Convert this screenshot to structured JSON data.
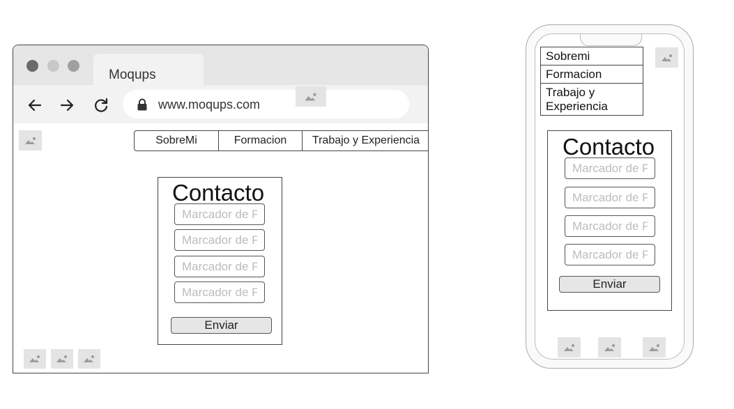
{
  "browser": {
    "tab_title": "Moqups",
    "url": "www.moqups.com",
    "icons": [
      "back-arrow-icon",
      "forward-arrow-icon",
      "reload-icon",
      "lock-icon"
    ]
  },
  "desktop": {
    "nav": [
      "SobreMi",
      "Formacion",
      "Trabajo y Experiencia"
    ],
    "contact": {
      "title": "Contacto",
      "placeholders": [
        "Marcador de Po",
        "Marcador de Po",
        "Marcador de Po",
        "Marcador de Po"
      ],
      "submit_label": "Enviar"
    },
    "footer_images": 3
  },
  "mobile": {
    "nav": [
      "Sobremi",
      "Formacion",
      "Trabajo y Experiencia"
    ],
    "contact": {
      "title": "Contacto",
      "placeholders": [
        "Marcador de Po",
        "Marcador de Po",
        "Marcador de Po",
        "Marcador de Po"
      ],
      "submit_label": "Enviar"
    },
    "footer_images": 3
  },
  "colors": {
    "chrome": "#e6e6e6",
    "border": "#444444",
    "placeholder": "#bbbbbb",
    "image_placeholder": "#e4e4e4"
  }
}
